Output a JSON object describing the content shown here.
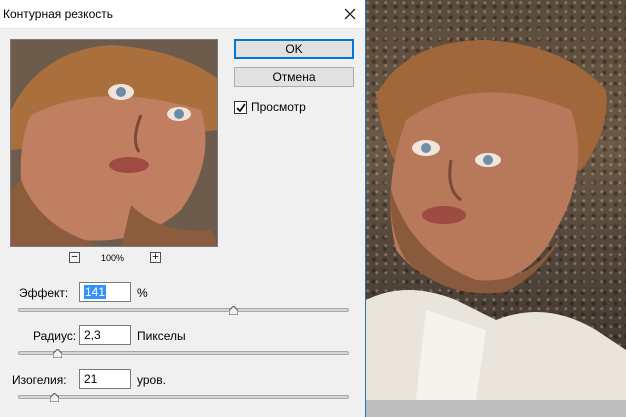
{
  "dialog": {
    "title": "Контурная резкость",
    "ok_label": "OK",
    "cancel_label": "Отмена",
    "preview_label": "Просмотр",
    "preview_checked": true,
    "zoom": {
      "minus_label": "−",
      "level": "100%",
      "plus_label": "+"
    },
    "fields": {
      "effect": {
        "label": "Эффект:",
        "value": "141",
        "unit": "%",
        "slider_fraction": 0.65
      },
      "radius": {
        "label": "Радиус:",
        "value": "2,3",
        "unit": "Пикселы",
        "slider_fraction": 0.12
      },
      "threshold": {
        "label": "Изогелия:",
        "value": "21",
        "unit": "уров.",
        "slider_fraction": 0.11
      }
    }
  },
  "icons": {
    "close": "close-icon",
    "check": "checkmark-icon"
  },
  "colors": {
    "accent": "#0078d7",
    "selection": "#3390ff",
    "dialog_bg": "#f0f0f0",
    "window_border": "#1e78c8"
  }
}
